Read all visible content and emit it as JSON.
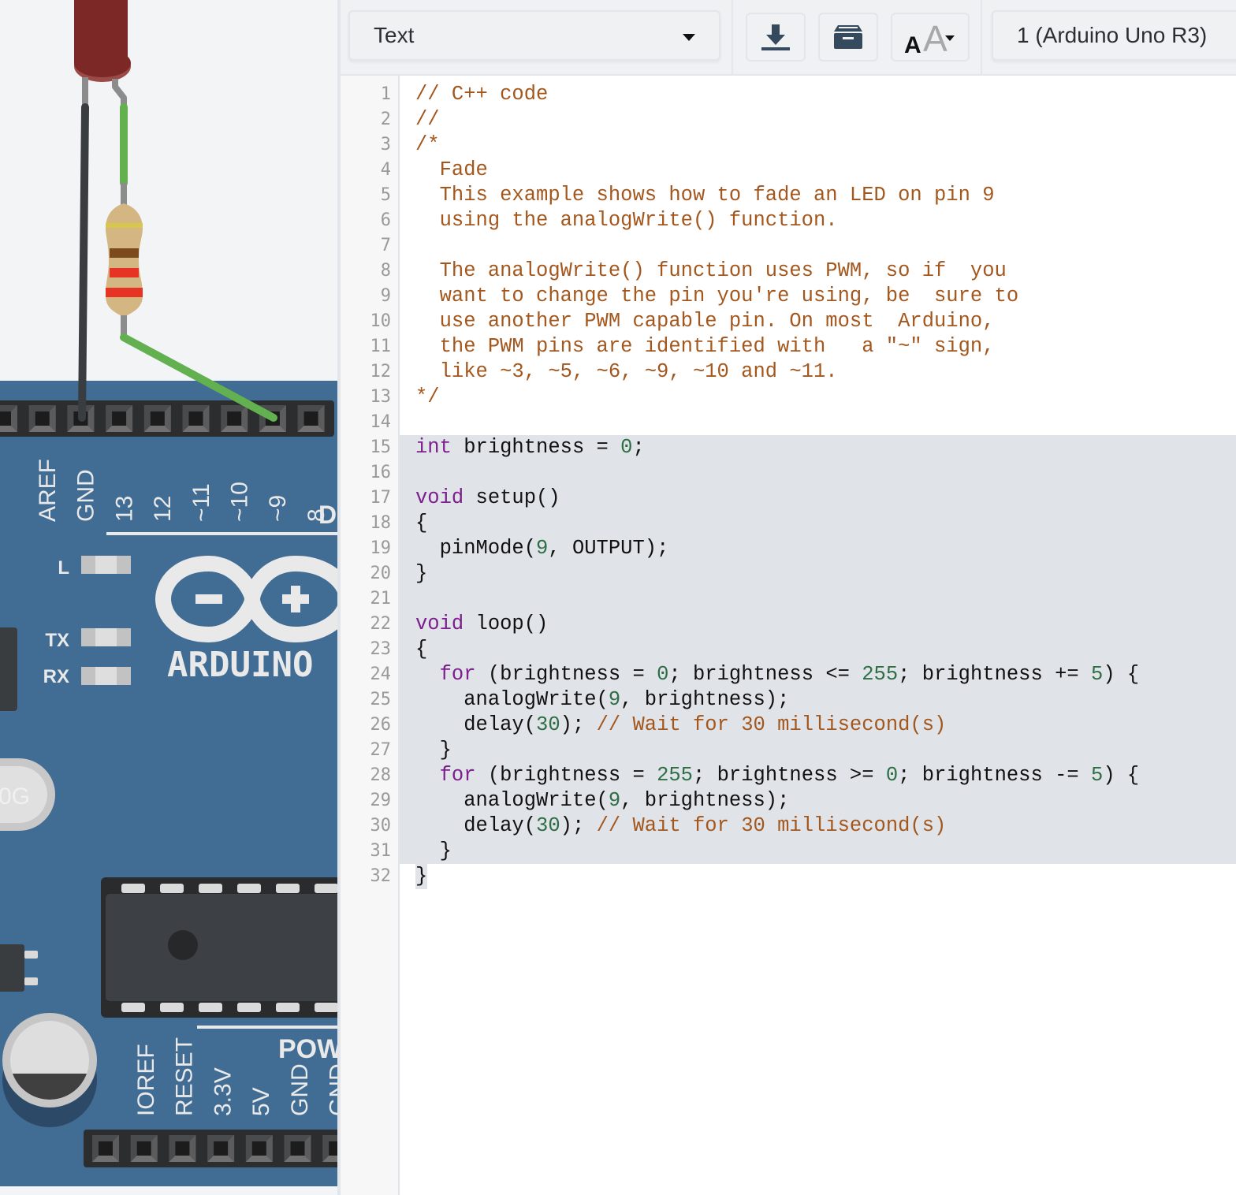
{
  "toolbar": {
    "mode_label": "Text",
    "download_icon": "download-icon",
    "library_icon": "library-icon",
    "font_size_icon": "font-size-icon",
    "device_label": "1 (Arduino Uno R3)"
  },
  "board": {
    "digital_pins": [
      "AREF",
      "GND",
      "13",
      "12",
      "~11",
      "~10",
      "~9",
      "8"
    ],
    "digital_section_label": "D",
    "led_labels": [
      "L",
      "TX",
      "RX"
    ],
    "logo_text": "ARDUINO",
    "crystal_label": "0G",
    "power_pins": [
      "IOREF",
      "RESET",
      "3.3V",
      "5V",
      "GND",
      "GND"
    ],
    "power_section_label": "POW"
  },
  "components": {
    "led_color": "#7b2826",
    "resistor_bands": [
      "#d6c84d",
      "#7d4a1e",
      "#e63324",
      "#e63324"
    ],
    "wire_gnd_color": "#3a3d40",
    "wire_signal_color": "#63b050",
    "board_color": "#416d94"
  },
  "editor": {
    "selection_start_line": 15,
    "selection_end_line": 32,
    "lines": [
      [
        {
          "t": "// C++ code",
          "s": "c"
        }
      ],
      [
        {
          "t": "//",
          "s": "c"
        }
      ],
      [
        {
          "t": "/*",
          "s": "c"
        }
      ],
      [
        {
          "t": "  Fade",
          "s": "c"
        }
      ],
      [
        {
          "t": "  This example shows how to fade an LED on pin 9",
          "s": "c"
        }
      ],
      [
        {
          "t": "  using the analogWrite() function.",
          "s": "c"
        }
      ],
      [
        {
          "t": "",
          "s": ""
        }
      ],
      [
        {
          "t": "  The analogWrite() function uses PWM, so if  you",
          "s": "c"
        }
      ],
      [
        {
          "t": "  want to change the pin you're using, be  sure to",
          "s": "c"
        }
      ],
      [
        {
          "t": "  use another PWM capable pin. On most  Arduino,",
          "s": "c"
        }
      ],
      [
        {
          "t": "  the PWM pins are identified with   a \"~\" sign,",
          "s": "c"
        }
      ],
      [
        {
          "t": "  like ~3, ~5, ~6, ~9, ~10 and ~11.",
          "s": "c"
        }
      ],
      [
        {
          "t": "*/",
          "s": "c"
        }
      ],
      [
        {
          "t": "",
          "s": ""
        }
      ],
      [
        {
          "t": "int",
          "s": "k"
        },
        {
          "t": " brightness = ",
          "s": ""
        },
        {
          "t": "0",
          "s": "n"
        },
        {
          "t": ";",
          "s": ""
        }
      ],
      [
        {
          "t": "",
          "s": ""
        }
      ],
      [
        {
          "t": "void",
          "s": "k"
        },
        {
          "t": " setup()",
          "s": ""
        }
      ],
      [
        {
          "t": "{",
          "s": ""
        }
      ],
      [
        {
          "t": "  pinMode(",
          "s": ""
        },
        {
          "t": "9",
          "s": "n"
        },
        {
          "t": ", OUTPUT);",
          "s": ""
        }
      ],
      [
        {
          "t": "}",
          "s": ""
        }
      ],
      [
        {
          "t": "",
          "s": ""
        }
      ],
      [
        {
          "t": "void",
          "s": "k"
        },
        {
          "t": " loop()",
          "s": ""
        }
      ],
      [
        {
          "t": "{",
          "s": ""
        }
      ],
      [
        {
          "t": "  ",
          "s": ""
        },
        {
          "t": "for",
          "s": "k"
        },
        {
          "t": " (brightness = ",
          "s": ""
        },
        {
          "t": "0",
          "s": "n"
        },
        {
          "t": "; brightness <= ",
          "s": ""
        },
        {
          "t": "255",
          "s": "n"
        },
        {
          "t": "; brightness += ",
          "s": ""
        },
        {
          "t": "5",
          "s": "n"
        },
        {
          "t": ") {",
          "s": ""
        }
      ],
      [
        {
          "t": "    analogWrite(",
          "s": ""
        },
        {
          "t": "9",
          "s": "n"
        },
        {
          "t": ", brightness);",
          "s": ""
        }
      ],
      [
        {
          "t": "    delay(",
          "s": ""
        },
        {
          "t": "30",
          "s": "n"
        },
        {
          "t": "); ",
          "s": ""
        },
        {
          "t": "// Wait for 30 millisecond(s)",
          "s": "c"
        }
      ],
      [
        {
          "t": "  }",
          "s": ""
        }
      ],
      [
        {
          "t": "  ",
          "s": ""
        },
        {
          "t": "for",
          "s": "k"
        },
        {
          "t": " (brightness = ",
          "s": ""
        },
        {
          "t": "255",
          "s": "n"
        },
        {
          "t": "; brightness >= ",
          "s": ""
        },
        {
          "t": "0",
          "s": "n"
        },
        {
          "t": "; brightness -= ",
          "s": ""
        },
        {
          "t": "5",
          "s": "n"
        },
        {
          "t": ") {",
          "s": ""
        }
      ],
      [
        {
          "t": "    analogWrite(",
          "s": ""
        },
        {
          "t": "9",
          "s": "n"
        },
        {
          "t": ", brightness);",
          "s": ""
        }
      ],
      [
        {
          "t": "    delay(",
          "s": ""
        },
        {
          "t": "30",
          "s": "n"
        },
        {
          "t": "); ",
          "s": ""
        },
        {
          "t": "// Wait for 30 millisecond(s)",
          "s": "c"
        }
      ],
      [
        {
          "t": "  }",
          "s": ""
        }
      ],
      [
        {
          "t": "}",
          "s": ""
        }
      ]
    ]
  }
}
